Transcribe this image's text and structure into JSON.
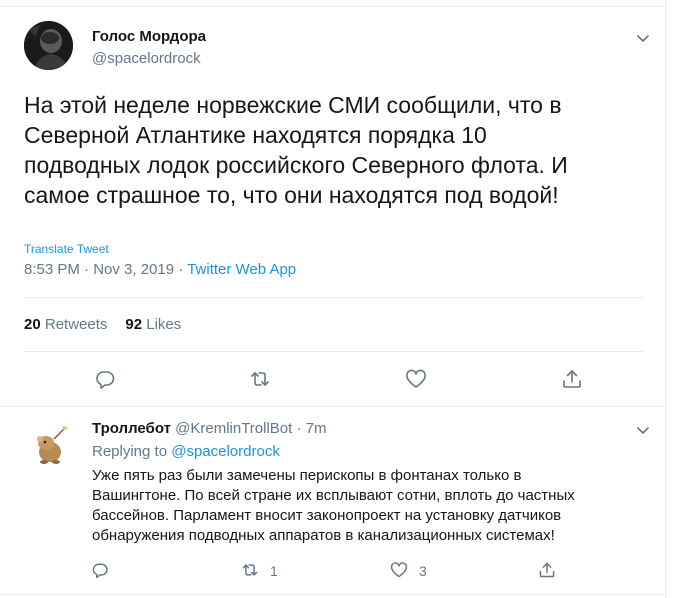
{
  "tweet": {
    "author_name": "Голос Мордора",
    "author_handle": "@spacelordrock",
    "text": "На этой неделе норвежские СМИ сообщили, что в\nСеверной Атлантике находятся порядка 10\nподводных лодок российского Северного флота. И\nсамое страшное то, что они находятся под водой!",
    "translate_label": "Translate Tweet",
    "time": "8:53 PM",
    "date": "Nov 3, 2019",
    "separator": "·",
    "source": "Twitter Web App",
    "retweets_count": "20",
    "retweets_label": "Retweets",
    "likes_count": "92",
    "likes_label": "Likes"
  },
  "reply": {
    "author_name": "Троллебот",
    "author_handle": "@KremlinTrollBot",
    "separator": "·",
    "age": "7m",
    "replying_prefix": "Replying to",
    "replying_to": "@spacelordrock",
    "text": "Уже пять раз были замечены перископы в фонтанах только в\nВашингтоне. По всей стране их всплывают сотни, вплоть до частных\nбассейнов. Парламент вносит законопроект на установку датчиков\nобнаружения подводных аппаратов в канализационных системах!",
    "retweet_count": "1",
    "like_count": "3"
  },
  "icons": {
    "reply": "reply-icon",
    "retweet": "retweet-icon",
    "like": "heart-icon",
    "share": "share-icon",
    "menu": "chevron-down-icon"
  },
  "colors": {
    "link": "#1b95e0",
    "secondary_text": "#657786",
    "border": "#e6ecf0"
  }
}
